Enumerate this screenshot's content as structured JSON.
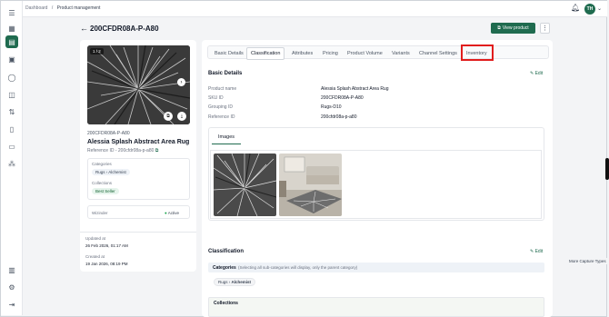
{
  "breadcrumb": {
    "root": "Dashboard",
    "sep": "/",
    "current": "Product management"
  },
  "user": {
    "initials": "TH"
  },
  "header": {
    "title": "200CFDR08A-P-A80",
    "view_button": "View product"
  },
  "product": {
    "image_counter": "1 / 2",
    "sku_code": "200CFDR08A-P-A80",
    "name": "Alessia Splash Abstract Area Rug",
    "reference": "Reference ID - 200cfdr08a-p-a80",
    "categories_label": "Categories",
    "category_path": [
      "Rugs",
      "Alchemist"
    ],
    "collections_label": "Collections",
    "collection_tag": "Best Seller",
    "wizinder_label": "Wizinder",
    "status": "Active",
    "updated_label": "Updated at",
    "updated_value": "26 Feb 2026, 01:17 AM",
    "created_label": "Created at",
    "created_value": "19 Jan 2026, 08:19 PM"
  },
  "tabs": [
    "Basic Details",
    "Classification",
    "Attributes",
    "Pricing",
    "Product Volume",
    "Variants",
    "Channel Settings",
    "Inventory"
  ],
  "active_tab": "Classification",
  "basic_details": {
    "title": "Basic Details",
    "edit": "Edit",
    "rows": [
      {
        "label": "Product name",
        "value": "Alessia Splash Abstract Area Rug"
      },
      {
        "label": "SKU ID",
        "value": "200CFDR08A-P-A80"
      },
      {
        "label": "Grouping ID",
        "value": "Rugs-D10"
      },
      {
        "label": "Reference ID",
        "value": "200cfdr08a-p-a80"
      }
    ],
    "images_tab": "Images"
  },
  "classification": {
    "title": "Classification",
    "edit": "Edit",
    "categories_heading": "Categories",
    "categories_note": "(Selecting all sub-categories will display, only the parent category)",
    "path": [
      "Rugs",
      "Alchemist"
    ],
    "collections_heading": "Collections"
  },
  "tooltip": "More Capture Types",
  "colors": {
    "brand": "#1f6b4f",
    "highlight": "#e11d1d"
  }
}
